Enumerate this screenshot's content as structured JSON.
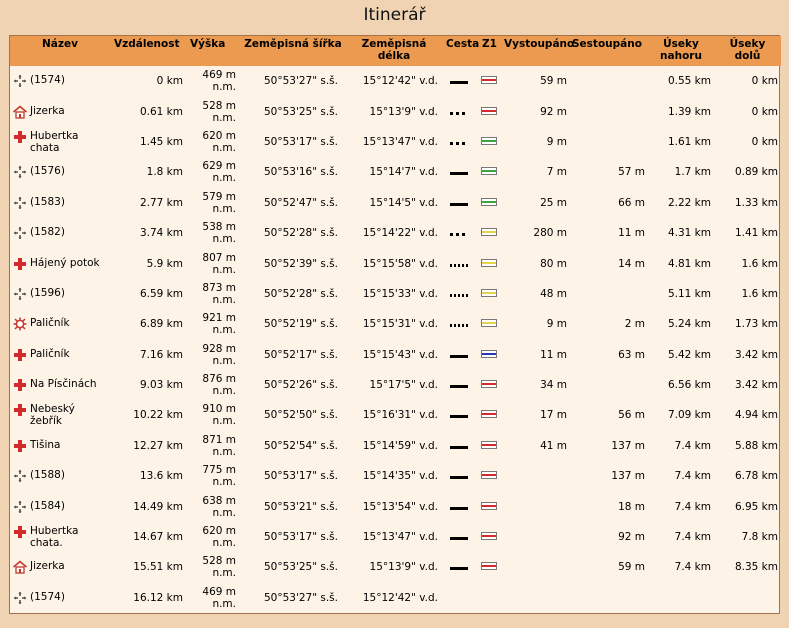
{
  "title": "Itinerář",
  "columns": {
    "name": "Název",
    "distance": "Vzdálenost",
    "altitude": "Výška",
    "latitude": "Zeměpisná šířka",
    "longitude": "Zeměpisná délka",
    "way": "Cesta",
    "z1": "Z1",
    "ascended": "Vystoupáno",
    "descended": "Sestoupáno",
    "segments_up": "Úseky nahoru",
    "segments_down": "Úseky dolů"
  },
  "colors": {
    "header_bg": "#eb9a50",
    "page_bg": "#efd3b3",
    "table_bg": "#fdf3e6",
    "red_marker": "#d32b2b",
    "green_marker": "#3aa53a",
    "yellow_marker": "#e3d44a",
    "blue_marker": "#2838b0"
  },
  "rows": [
    {
      "icon": "crossroad-icon",
      "name": "(1574)",
      "distance": "0 km",
      "altitude": "469 m n.m.",
      "lat": "50°53'27\" s.š.",
      "lon": "15°12'42\" v.d.",
      "way": "solid",
      "mark": "red",
      "up": "59 m",
      "down": "",
      "seg_up": "0.55 km",
      "seg_down": "0 km"
    },
    {
      "icon": "hut-icon",
      "name": "Jizerka",
      "distance": "0.61 km",
      "altitude": "528 m n.m.",
      "lat": "50°53'25\" s.š.",
      "lon": "15°13'9\" v.d.",
      "way": "dashed",
      "mark": "red",
      "up": "92 m",
      "down": "",
      "seg_up": "1.39 km",
      "seg_down": "0 km"
    },
    {
      "icon": "red-cross-icon",
      "name": "Hubertka chata",
      "distance": "1.45 km",
      "altitude": "620 m n.m.",
      "lat": "50°53'17\" s.š.",
      "lon": "15°13'47\" v.d.",
      "way": "dashed",
      "mark": "green",
      "up": "9 m",
      "down": "",
      "seg_up": "1.61 km",
      "seg_down": "0 km"
    },
    {
      "icon": "crossroad-icon",
      "name": "(1576)",
      "distance": "1.8 km",
      "altitude": "629 m n.m.",
      "lat": "50°53'16\" s.š.",
      "lon": "15°14'7\" v.d.",
      "way": "solid",
      "mark": "green",
      "up": "7 m",
      "down": "57 m",
      "seg_up": "1.7 km",
      "seg_down": "0.89 km"
    },
    {
      "icon": "crossroad-icon",
      "name": "(1583)",
      "distance": "2.77 km",
      "altitude": "579 m n.m.",
      "lat": "50°52'47\" s.š.",
      "lon": "15°14'5\" v.d.",
      "way": "solid",
      "mark": "green",
      "up": "25 m",
      "down": "66 m",
      "seg_up": "2.22 km",
      "seg_down": "1.33 km"
    },
    {
      "icon": "crossroad-icon",
      "name": "(1582)",
      "distance": "3.74 km",
      "altitude": "538 m n.m.",
      "lat": "50°52'28\" s.š.",
      "lon": "15°14'22\" v.d.",
      "way": "dashed",
      "mark": "yellow",
      "up": "280 m",
      "down": "11 m",
      "seg_up": "4.31 km",
      "seg_down": "1.41 km"
    },
    {
      "icon": "red-cross-icon",
      "name": "Hájený potok",
      "distance": "5.9 km",
      "altitude": "807 m n.m.",
      "lat": "50°52'39\" s.š.",
      "lon": "15°15'58\" v.d.",
      "way": "dotted",
      "mark": "yellow",
      "up": "80 m",
      "down": "14 m",
      "seg_up": "4.81 km",
      "seg_down": "1.6 km"
    },
    {
      "icon": "crossroad-icon",
      "name": "(1596)",
      "distance": "6.59 km",
      "altitude": "873 m n.m.",
      "lat": "50°52'28\" s.š.",
      "lon": "15°15'33\" v.d.",
      "way": "dotted",
      "mark": "yellow",
      "up": "48 m",
      "down": "",
      "seg_up": "5.11 km",
      "seg_down": "1.6 km"
    },
    {
      "icon": "viewpoint-icon",
      "name": "Paličník",
      "distance": "6.89 km",
      "altitude": "921 m n.m.",
      "lat": "50°52'19\" s.š.",
      "lon": "15°15'31\" v.d.",
      "way": "dotted",
      "mark": "yellow",
      "up": "9 m",
      "down": "2 m",
      "seg_up": "5.24 km",
      "seg_down": "1.73 km"
    },
    {
      "icon": "red-cross-icon",
      "name": "Paličník",
      "distance": "7.16 km",
      "altitude": "928 m n.m.",
      "lat": "50°52'17\" s.š.",
      "lon": "15°15'43\" v.d.",
      "way": "solid",
      "mark": "blue",
      "up": "11 m",
      "down": "63 m",
      "seg_up": "5.42 km",
      "seg_down": "3.42 km"
    },
    {
      "icon": "red-cross-icon",
      "name": "Na Písčinách",
      "distance": "9.03 km",
      "altitude": "876 m n.m.",
      "lat": "50°52'26\" s.š.",
      "lon": "15°17'5\" v.d.",
      "way": "solid",
      "mark": "red",
      "up": "34 m",
      "down": "",
      "seg_up": "6.56 km",
      "seg_down": "3.42 km"
    },
    {
      "icon": "red-cross-icon",
      "name": "Nebeský žebřík",
      "distance": "10.22 km",
      "altitude": "910 m n.m.",
      "lat": "50°52'50\" s.š.",
      "lon": "15°16'31\" v.d.",
      "way": "solid",
      "mark": "red",
      "up": "17 m",
      "down": "56 m",
      "seg_up": "7.09 km",
      "seg_down": "4.94 km"
    },
    {
      "icon": "red-cross-icon",
      "name": "Tišina",
      "distance": "12.27 km",
      "altitude": "871 m n.m.",
      "lat": "50°52'54\" s.š.",
      "lon": "15°14'59\" v.d.",
      "way": "solid",
      "mark": "red",
      "up": "41 m",
      "down": "137 m",
      "seg_up": "7.4 km",
      "seg_down": "5.88 km"
    },
    {
      "icon": "crossroad-icon",
      "name": "(1588)",
      "distance": "13.6 km",
      "altitude": "775 m n.m.",
      "lat": "50°53'17\" s.š.",
      "lon": "15°14'35\" v.d.",
      "way": "solid",
      "mark": "red",
      "up": "",
      "down": "137 m",
      "seg_up": "7.4 km",
      "seg_down": "6.78 km"
    },
    {
      "icon": "crossroad-icon",
      "name": "(1584)",
      "distance": "14.49 km",
      "altitude": "638 m n.m.",
      "lat": "50°53'21\" s.š.",
      "lon": "15°13'54\" v.d.",
      "way": "solid",
      "mark": "red",
      "up": "",
      "down": "18 m",
      "seg_up": "7.4 km",
      "seg_down": "6.95 km"
    },
    {
      "icon": "red-cross-icon",
      "name": "Hubertka chata.",
      "distance": "14.67 km",
      "altitude": "620 m n.m.",
      "lat": "50°53'17\" s.š.",
      "lon": "15°13'47\" v.d.",
      "way": "solid",
      "mark": "red",
      "up": "",
      "down": "92 m",
      "seg_up": "7.4 km",
      "seg_down": "7.8 km"
    },
    {
      "icon": "hut-icon",
      "name": "Jizerka",
      "distance": "15.51 km",
      "altitude": "528 m n.m.",
      "lat": "50°53'25\" s.š.",
      "lon": "15°13'9\" v.d.",
      "way": "solid",
      "mark": "red",
      "up": "",
      "down": "59 m",
      "seg_up": "7.4 km",
      "seg_down": "8.35 km"
    },
    {
      "icon": "crossroad-icon",
      "name": "(1574)",
      "distance": "16.12 km",
      "altitude": "469 m n.m.",
      "lat": "50°53'27\" s.š.",
      "lon": "15°12'42\" v.d.",
      "way": "",
      "mark": "",
      "up": "",
      "down": "",
      "seg_up": "",
      "seg_down": ""
    }
  ]
}
